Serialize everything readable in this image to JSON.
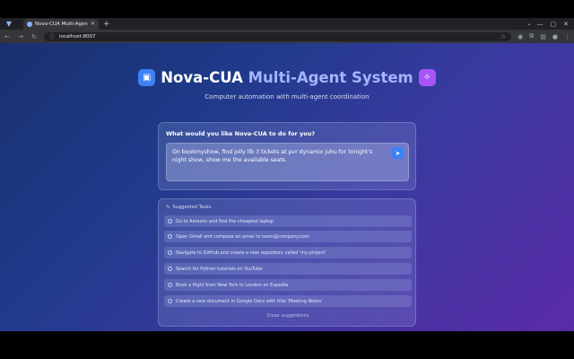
{
  "browser": {
    "tab_title": "Nova-CUA Multi-Agent S",
    "url": "localhost:8007"
  },
  "header": {
    "title_main": "Nova-CUA",
    "title_accent": "Multi-Agent System",
    "subtitle": "Computer automation with multi-agent coordination"
  },
  "ask": {
    "label": "What would you like Nova-CUA to do for you?",
    "value": "On bookmyshow, find jolly llb 3 tickets at pvr dynamix juhu for tonight's night show, show me the available seats."
  },
  "suggestions": {
    "heading": "Suggested Tasks",
    "items": [
      "Go to Amazon and find the cheapest laptop",
      "Open Gmail and compose an email to team@company.com",
      "Navigate to GitHub and create a new repository called 'my-project'",
      "Search for Python tutorials on YouTube",
      "Book a flight from New York to London on Expedia",
      "Create a new document in Google Docs with title 'Meeting Notes'"
    ],
    "close_label": "Close suggestions"
  },
  "colors": {
    "accent_blue": "#3b82f6",
    "accent_purple": "#a855f7"
  }
}
